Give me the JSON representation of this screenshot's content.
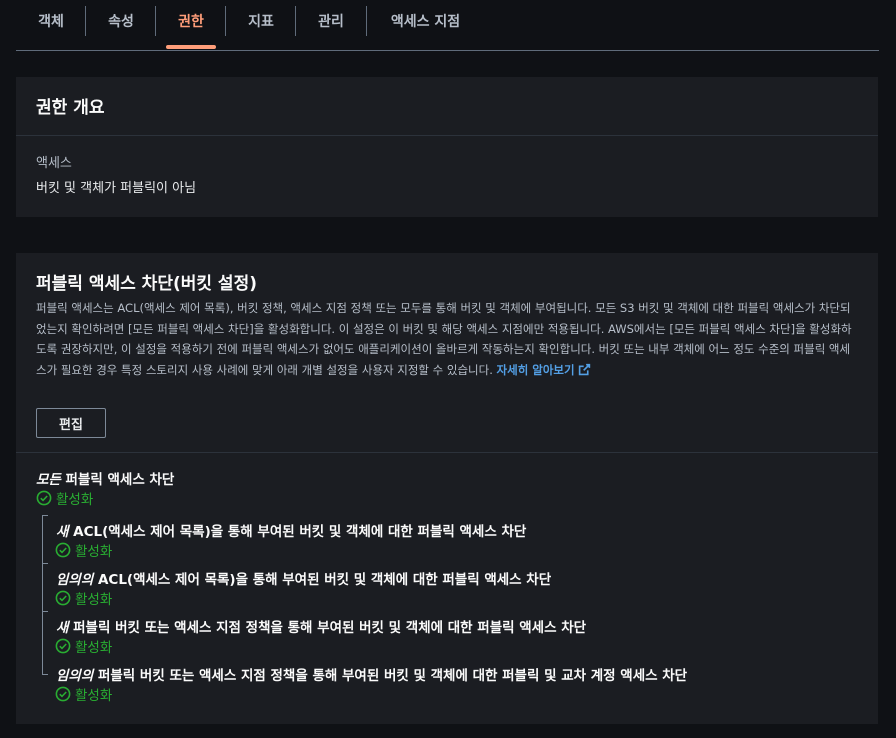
{
  "tabs": [
    {
      "label": "객체"
    },
    {
      "label": "속성"
    },
    {
      "label": "권한"
    },
    {
      "label": "지표"
    },
    {
      "label": "관리"
    },
    {
      "label": "액세스 지점"
    }
  ],
  "permissions_overview": {
    "title": "권한 개요",
    "access_label": "액세스",
    "access_value": "버킷 및 객체가 퍼블릭이 아님"
  },
  "block_public_access": {
    "title": "퍼블릭 액세스 차단(버킷 설정)",
    "description": "퍼블릭 액세스는 ACL(액세스 제어 목록), 버킷 정책, 액세스 지점 정책 또는 모두를 통해 버킷 및 객체에 부여됩니다. 모든 S3 버킷 및 객체에 대한 퍼블릭 액세스가 차단되었는지 확인하려면 [모든 퍼블릭 액세스 차단]을 활성화합니다. 이 설정은 이 버킷 및 해당 액세스 지점에만 적용됩니다. AWS에서는 [모든 퍼블릭 액세스 차단]을 활성화하도록 권장하지만, 이 설정을 적용하기 전에 퍼블릭 액세스가 없어도 애플리케이션이 올바르게 작동하는지 확인합니다. 버킷 또는 내부 객체에 어느 정도 수준의 퍼블릭 액세스가 필요한 경우 특정 스토리지 사용 사례에 맞게 아래 개별 설정을 사용자 지정할 수 있습니다.",
    "learn_more": "자세히 알아보기",
    "edit_label": "편집",
    "settings": [
      {
        "prefix": "모든",
        "text": "퍼블릭 액세스 차단",
        "status": "활성화"
      },
      {
        "prefix": "새",
        "text": "ACL(액세스 제어 목록)을 통해 부여된 버킷 및 객체에 대한 퍼블릭 액세스 차단",
        "status": "활성화"
      },
      {
        "prefix": "임의의",
        "text": "ACL(액세스 제어 목록)을 통해 부여된 버킷 및 객체에 대한 퍼블릭 액세스 차단",
        "status": "활성화"
      },
      {
        "prefix": "새",
        "text": "퍼블릭 버킷 또는 액세스 지점 정책을 통해 부여된 버킷 및 객체에 대한 퍼블릭 액세스 차단",
        "status": "활성화"
      },
      {
        "prefix": "임의의",
        "text": "퍼블릭 버킷 또는 액세스 지점 정책을 통해 부여된 버킷 및 객체에 대한 퍼블릭 및 교차 계정 액세스 차단",
        "status": "활성화"
      }
    ]
  },
  "colors": {
    "background": "#0f1115",
    "panel": "#1b1d22",
    "active_tab": "#ff9e7a",
    "link": "#539fe5",
    "success": "#29ad32"
  },
  "icons": {
    "status": "check-circle-icon",
    "external_link": "external-link-icon"
  }
}
